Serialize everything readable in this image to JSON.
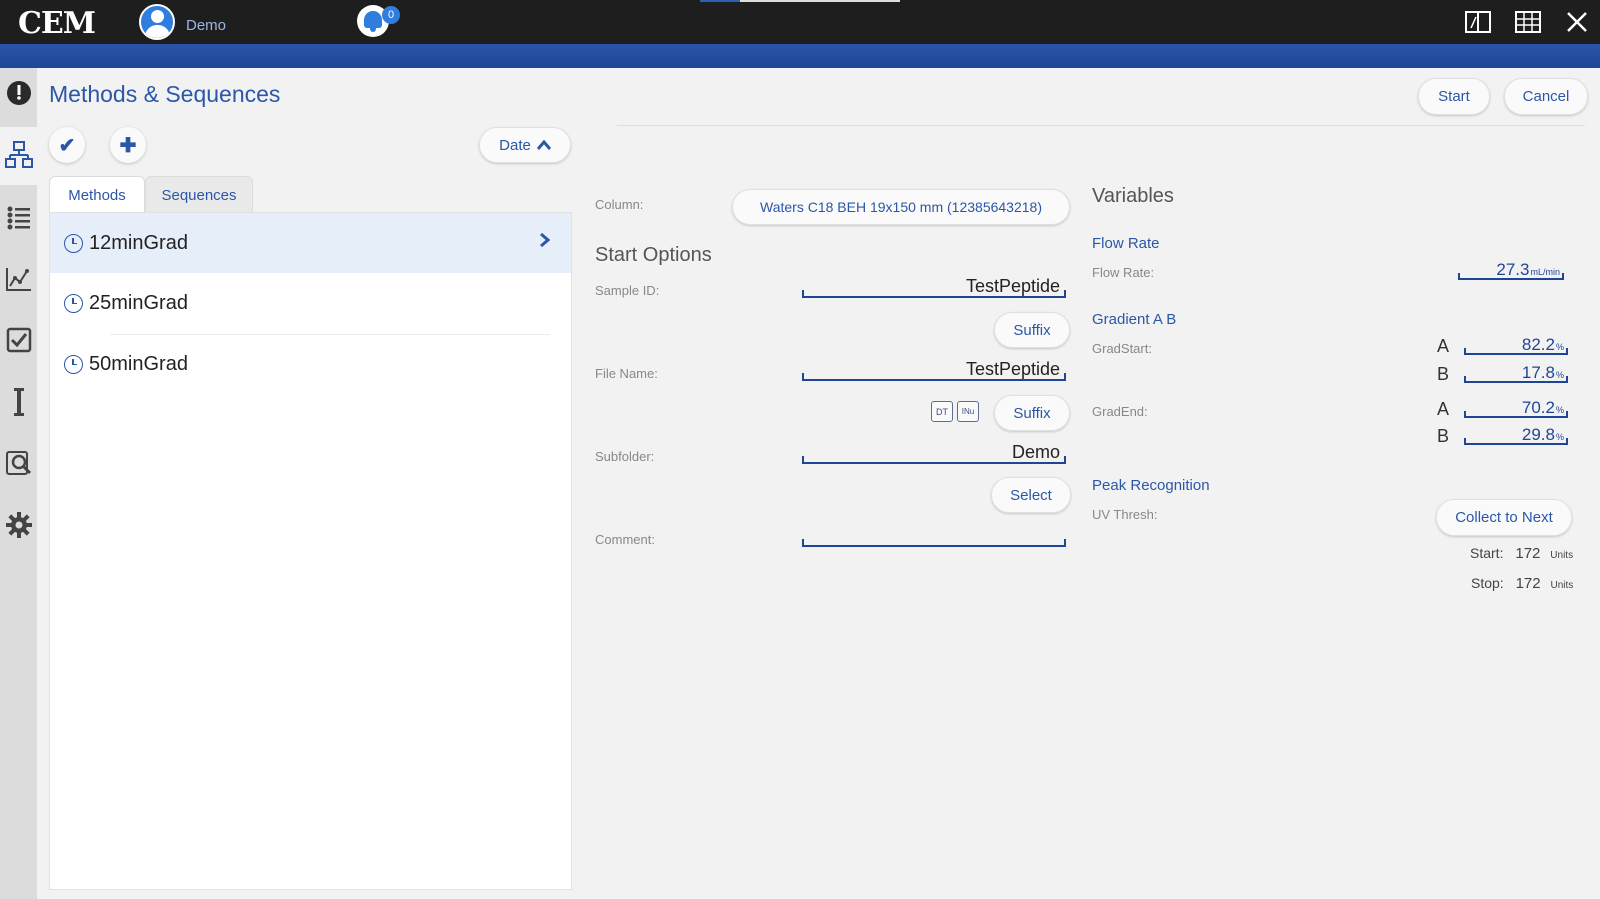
{
  "app": {
    "logo": "CEM",
    "user": "Demo",
    "notifications": "0"
  },
  "page": {
    "title": "Methods & Sequences"
  },
  "actions": {
    "start": "Start",
    "cancel": "Cancel",
    "sort": "Date"
  },
  "tabs": [
    "Methods",
    "Sequences"
  ],
  "methods": [
    {
      "name": "12minGrad",
      "selected": true
    },
    {
      "name": "25minGrad",
      "selected": false
    },
    {
      "name": "50minGrad",
      "selected": false
    }
  ],
  "start": {
    "column_label": "Column:",
    "column_value": "Waters C18 BEH 19x150 mm (12385643218)",
    "heading": "Start Options",
    "sample_id_label": "Sample ID:",
    "sample_id": "TestPeptide",
    "suffix": "Suffix",
    "file_name_label": "File Name:",
    "file_name": "TestPeptide",
    "dt": "DT",
    "inu": "INu",
    "subfolder_label": "Subfolder:",
    "subfolder": "Demo",
    "select": "Select",
    "comment_label": "Comment:",
    "comment": ""
  },
  "variables": {
    "heading": "Variables",
    "flow_rate_head": "Flow Rate",
    "flow_rate_label": "Flow Rate:",
    "flow_rate": "27.3",
    "flow_unit": "mL/min",
    "gradient_head": "Gradient A B",
    "grad_start_label": "GradStart:",
    "grad_end_label": "GradEnd:",
    "a": "A",
    "b": "B",
    "grad_start_a": "82.2",
    "grad_start_b": "17.8",
    "grad_end_a": "70.2",
    "grad_end_b": "29.8",
    "pct": "%",
    "peak_head": "Peak Recognition",
    "uv_label": "UV Thresh:",
    "collect": "Collect to Next",
    "start_label": "Start:",
    "start_val": "172",
    "stop_label": "Stop:",
    "stop_val": "172",
    "units": "Units"
  }
}
